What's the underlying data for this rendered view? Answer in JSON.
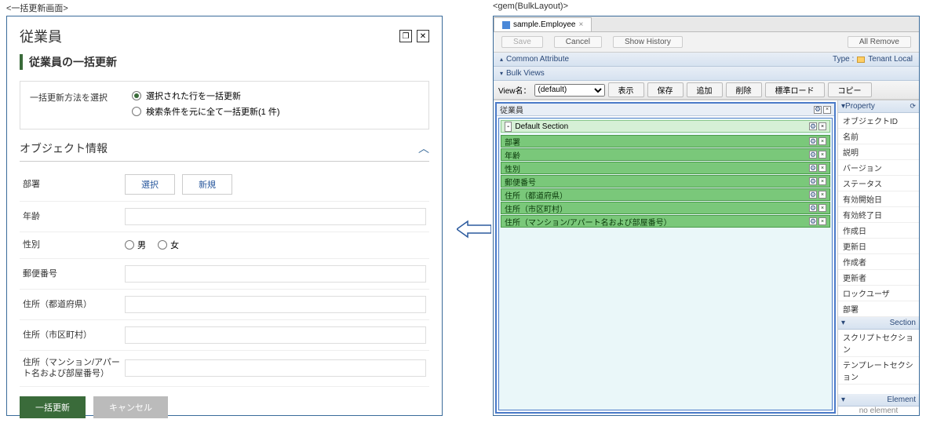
{
  "captions": {
    "left": "<一括更新画面>",
    "right": "<gem(BulkLayout)>"
  },
  "left": {
    "title": "従業員",
    "subtitle": "従業員の一括更新",
    "method_label": "一括更新方法を選択",
    "opt_selected": "選択された行を一括更新",
    "opt_search": "検索条件を元に全て一括更新(1 件)",
    "section_title": "オブジェクト情報",
    "fields": {
      "dept": "部署",
      "age": "年齢",
      "sex": "性別",
      "zip": "郵便番号",
      "pref": "住所（都道府県）",
      "city": "住所（市区町村）",
      "addr": "住所（マンション/アパート名および部屋番号）"
    },
    "btn_select": "選択",
    "btn_new": "新規",
    "male": "男",
    "female": "女",
    "btn_submit": "一括更新",
    "btn_cancel": "キャンセル"
  },
  "right": {
    "tab": "sample.Employee",
    "actions": {
      "save": "Save",
      "cancel": "Cancel",
      "history": "Show History",
      "remove": "All Remove"
    },
    "bar_common": "Common Attribute",
    "bar_type_label": "Type :",
    "bar_type_val": "Tenant Local",
    "bar_bulk": "Bulk Views",
    "toolbar": {
      "view_label": "View名：",
      "view_value": "(default)",
      "show": "表示",
      "save": "保存",
      "add": "追加",
      "del": "削除",
      "std": "標準ロード",
      "copy": "コピー"
    },
    "main_title": "従業員",
    "section_title": "Default Section",
    "fields": [
      "部署",
      "年齢",
      "性別",
      "郵便番号",
      "住所（都道府県）",
      "住所（市区町村）",
      "住所（マンション/アパート名および部屋番号）"
    ],
    "side": {
      "property": "Property",
      "props": [
        "オブジェクトID",
        "名前",
        "説明",
        "バージョン",
        "ステータス",
        "有効開始日",
        "有効終了日",
        "作成日",
        "更新日",
        "作成者",
        "更新者",
        "ロックユーザ",
        "部署"
      ],
      "section": "Section",
      "sections": [
        "スクリプトセクション",
        "テンプレートセクション"
      ],
      "element": "Element",
      "no_element": "no element"
    }
  }
}
